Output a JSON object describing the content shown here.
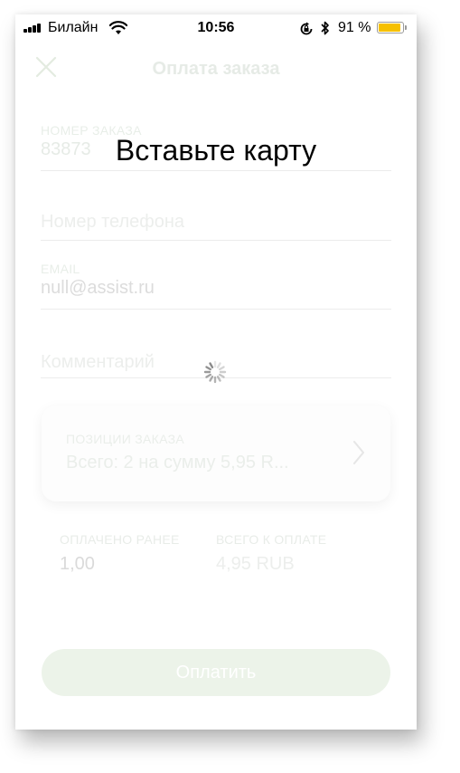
{
  "status_bar": {
    "carrier": "Билайн",
    "time": "10:56",
    "battery_percent": "91 %",
    "battery_level": 0.91,
    "icons": [
      "signal-icon",
      "wifi-icon",
      "orientation-lock-icon",
      "bluetooth-icon",
      "battery-icon"
    ]
  },
  "header": {
    "title": "Оплата заказа",
    "close_icon": "close-icon"
  },
  "form": {
    "order_number": {
      "label": "НОМЕР ЗАКАЗА",
      "value": "83873"
    },
    "phone": {
      "placeholder": "Номер телефона"
    },
    "email": {
      "label": "EMAIL",
      "value": "null@assist.ru"
    },
    "comment": {
      "placeholder": "Комментарий"
    }
  },
  "order_items": {
    "label": "ПОЗИЦИИ ЗАКАЗА",
    "summary": "Всего: 2 на сумму 5,95 R...",
    "chevron_icon": "chevron-right-icon"
  },
  "totals": {
    "paid_label": "ОПЛАЧЕНО РАНЕЕ",
    "paid_value": "1,00",
    "total_label": "ВСЕГО К ОПЛАТЕ",
    "total_value": "4,95 RUB"
  },
  "pay_button_label": "Оплатить",
  "overlay": {
    "message": "Вставьте карту",
    "spinner_icon": "loading-spinner-icon"
  },
  "colors": {
    "accent_faded": "#ecf3e9",
    "battery": "#f6c000"
  }
}
